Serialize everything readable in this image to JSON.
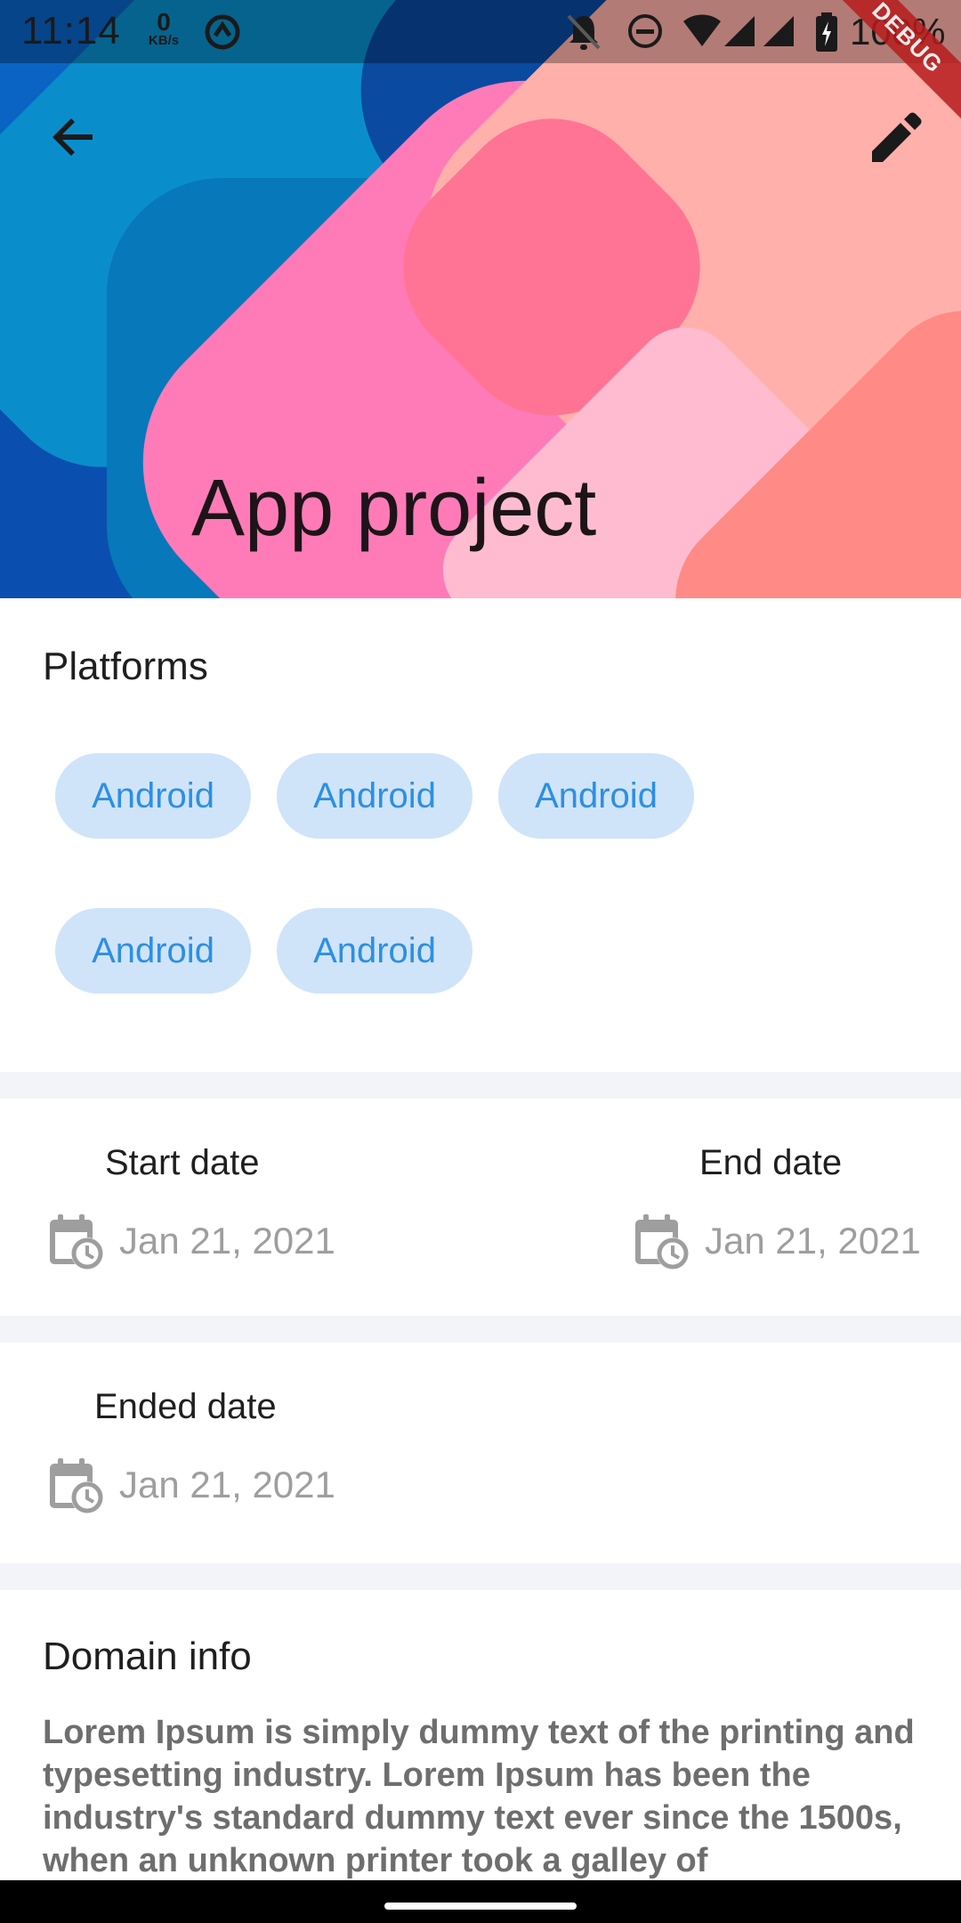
{
  "status_bar": {
    "time": "11:14",
    "net_speed_value": "0",
    "net_speed_unit": "KB/s",
    "battery_text": "100%",
    "icons": [
      "sync-icon",
      "notifications-off-icon",
      "do-not-disturb-icon",
      "wifi-icon",
      "signal-icon",
      "signal-icon",
      "battery-charging-icon"
    ]
  },
  "debug_banner": "DEBUG",
  "header": {
    "title": "App project",
    "back_icon": "arrow-back-icon",
    "edit_icon": "edit-pencil-icon"
  },
  "platforms": {
    "title": "Platforms",
    "chips": [
      "Android",
      "Android",
      "Android",
      "Android",
      "Android"
    ]
  },
  "dates": {
    "start_label": "Start date",
    "start_value": "Jan 21, 2021",
    "end_label": "End date",
    "end_value": "Jan 21, 2021",
    "ended_label": "Ended date",
    "ended_value": "Jan 21, 2021",
    "icon": "calendar-clock-icon"
  },
  "domain": {
    "title": "Domain info",
    "text": "Lorem Ipsum is simply dummy text of the printing and typesetting industry. Lorem Ipsum has been the industry's standard dummy text ever since the 1500s, when an unknown printer took a galley of"
  },
  "colors": {
    "chip_bg": "#cfe4f9",
    "chip_text": "#2d8fe3",
    "divider": "#f2f4f9",
    "date_value": "#9e9e9e"
  }
}
